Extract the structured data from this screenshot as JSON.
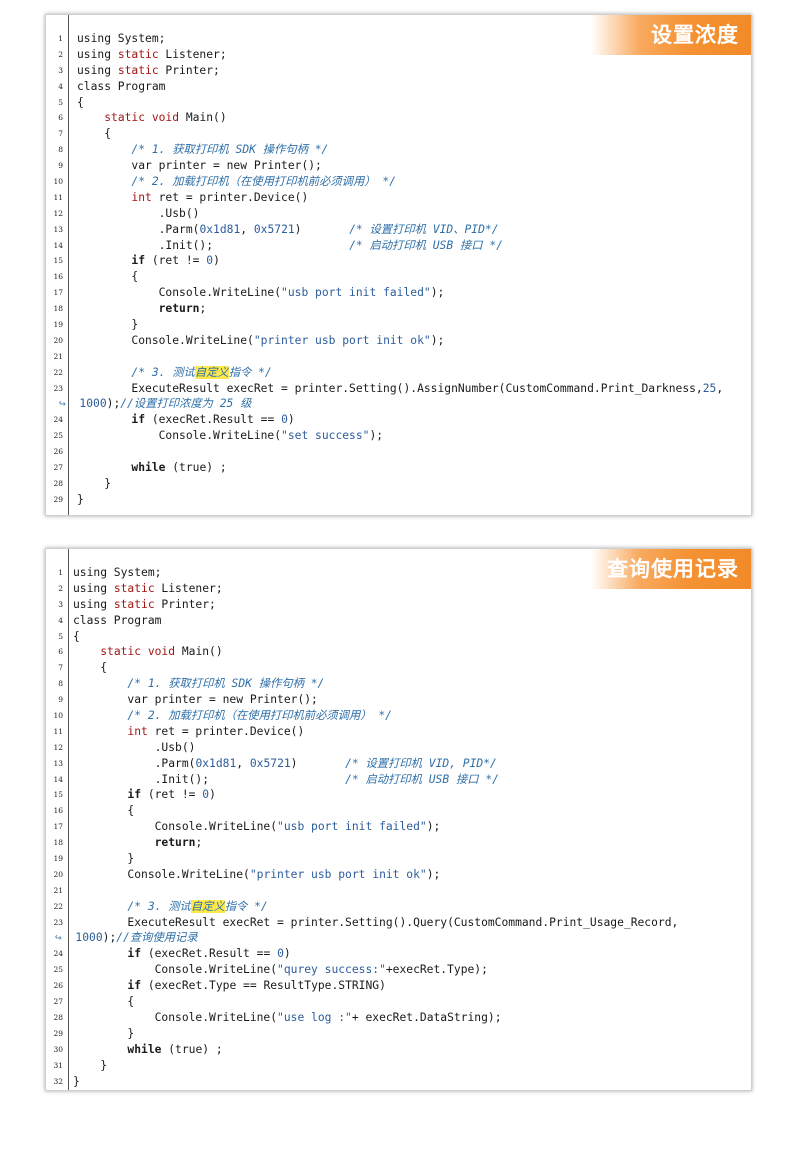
{
  "panels": [
    {
      "title": "设置浓度",
      "lines": [
        {
          "n": "1",
          "segs": [
            {
              "t": "using System;"
            }
          ]
        },
        {
          "n": "2",
          "segs": [
            {
              "t": "using "
            },
            {
              "t": "static",
              "c": "kw"
            },
            {
              "t": " Listener;"
            }
          ]
        },
        {
          "n": "3",
          "segs": [
            {
              "t": "using "
            },
            {
              "t": "static",
              "c": "kw"
            },
            {
              "t": " Printer;"
            }
          ]
        },
        {
          "n": "4",
          "segs": [
            {
              "t": "class Program"
            }
          ]
        },
        {
          "n": "5",
          "segs": [
            {
              "t": "{"
            }
          ]
        },
        {
          "n": "6",
          "segs": [
            {
              "t": "    "
            },
            {
              "t": "static void",
              "c": "kw"
            },
            {
              "t": " Main()"
            }
          ]
        },
        {
          "n": "7",
          "segs": [
            {
              "t": "    {"
            }
          ]
        },
        {
          "n": "8",
          "segs": [
            {
              "t": "        "
            },
            {
              "t": "/* 1. 获取打印机 SDK 操作句柄 */",
              "c": "cm"
            }
          ]
        },
        {
          "n": "9",
          "segs": [
            {
              "t": "        var printer = new Printer();"
            }
          ]
        },
        {
          "n": "10",
          "segs": [
            {
              "t": "        "
            },
            {
              "t": "/* 2. 加载打印机（在使用打印机前必须调用） */",
              "c": "cm"
            }
          ]
        },
        {
          "n": "11",
          "segs": [
            {
              "t": "        "
            },
            {
              "t": "int",
              "c": "kw"
            },
            {
              "t": " ret = printer.Device()"
            }
          ]
        },
        {
          "n": "12",
          "segs": [
            {
              "t": "            .Usb()"
            }
          ]
        },
        {
          "n": "13",
          "segs": [
            {
              "t": "            .Parm("
            },
            {
              "t": "0x1d81",
              "c": "nm"
            },
            {
              "t": ", "
            },
            {
              "t": "0x5721",
              "c": "nm"
            },
            {
              "t": ")       "
            },
            {
              "t": "/* 设置打印机 VID、PID*/",
              "c": "cm"
            }
          ]
        },
        {
          "n": "14",
          "segs": [
            {
              "t": "            .Init();                    "
            },
            {
              "t": "/* 启动打印机 USB 接口 */",
              "c": "cm"
            }
          ]
        },
        {
          "n": "15",
          "segs": [
            {
              "t": "        "
            },
            {
              "t": "if",
              "c": "kwb"
            },
            {
              "t": " (ret != "
            },
            {
              "t": "0",
              "c": "nm"
            },
            {
              "t": ")"
            }
          ]
        },
        {
          "n": "16",
          "segs": [
            {
              "t": "        {"
            }
          ]
        },
        {
          "n": "17",
          "segs": [
            {
              "t": "            Console.WriteLine("
            },
            {
              "t": "\"usb port init failed\"",
              "c": "st"
            },
            {
              "t": ");"
            }
          ]
        },
        {
          "n": "18",
          "segs": [
            {
              "t": "            "
            },
            {
              "t": "return",
              "c": "kwb"
            },
            {
              "t": ";"
            }
          ]
        },
        {
          "n": "19",
          "segs": [
            {
              "t": "        }"
            }
          ]
        },
        {
          "n": "20",
          "segs": [
            {
              "t": "        Console.WriteLine("
            },
            {
              "t": "\"printer usb port init ok\"",
              "c": "st"
            },
            {
              "t": ");"
            }
          ]
        },
        {
          "n": "21",
          "segs": [
            {
              "t": ""
            }
          ]
        },
        {
          "n": "22",
          "segs": [
            {
              "t": "        "
            },
            {
              "t": "/* 3. 测试",
              "c": "cm"
            },
            {
              "t": "自定义",
              "c": "cm hl"
            },
            {
              "t": "指令 */",
              "c": "cm"
            }
          ]
        },
        {
          "n": "23",
          "segs": [
            {
              "t": "        ExecuteResult execRet = printer.Setting().AssignNumber(CustomCommand.Print_Darkness,"
            },
            {
              "t": "25",
              "c": "nm"
            },
            {
              "t": ","
            }
          ]
        },
        {
          "n": "",
          "cont": true,
          "segs": [
            {
              "t": "↪ ",
              "c": "arrow"
            },
            {
              "t": " "
            },
            {
              "t": "1000",
              "c": "nm"
            },
            {
              "t": ");"
            },
            {
              "t": "//设置打印浓度为 25 级",
              "c": "cm"
            }
          ]
        },
        {
          "n": "24",
          "segs": [
            {
              "t": "        "
            },
            {
              "t": "if",
              "c": "kwb"
            },
            {
              "t": " (execRet.Result == "
            },
            {
              "t": "0",
              "c": "nm"
            },
            {
              "t": ")"
            }
          ]
        },
        {
          "n": "25",
          "segs": [
            {
              "t": "            Console.WriteLine("
            },
            {
              "t": "\"set success\"",
              "c": "st"
            },
            {
              "t": ");"
            }
          ]
        },
        {
          "n": "26",
          "segs": [
            {
              "t": ""
            }
          ]
        },
        {
          "n": "27",
          "segs": [
            {
              "t": "        "
            },
            {
              "t": "while",
              "c": "kwb"
            },
            {
              "t": " (true) ;"
            }
          ]
        },
        {
          "n": "28",
          "segs": [
            {
              "t": "    }"
            }
          ]
        },
        {
          "n": "29",
          "segs": [
            {
              "t": "}"
            }
          ]
        }
      ]
    },
    {
      "title": "查询使用记录",
      "lines": [
        {
          "n": "1",
          "segs": [
            {
              "t": "using System;"
            }
          ]
        },
        {
          "n": "2",
          "segs": [
            {
              "t": "using "
            },
            {
              "t": "static",
              "c": "kw"
            },
            {
              "t": " Listener;"
            }
          ]
        },
        {
          "n": "3",
          "segs": [
            {
              "t": "using "
            },
            {
              "t": "static",
              "c": "kw"
            },
            {
              "t": " Printer;"
            }
          ]
        },
        {
          "n": "4",
          "segs": [
            {
              "t": "class Program"
            }
          ]
        },
        {
          "n": "5",
          "segs": [
            {
              "t": "{"
            }
          ]
        },
        {
          "n": "6",
          "segs": [
            {
              "t": "    "
            },
            {
              "t": "static void",
              "c": "kw"
            },
            {
              "t": " Main()"
            }
          ]
        },
        {
          "n": "7",
          "segs": [
            {
              "t": "    {"
            }
          ]
        },
        {
          "n": "8",
          "segs": [
            {
              "t": "        "
            },
            {
              "t": "/* 1. 获取打印机 SDK 操作句柄 */",
              "c": "cm"
            }
          ]
        },
        {
          "n": "9",
          "segs": [
            {
              "t": "        var printer = new Printer();"
            }
          ]
        },
        {
          "n": "10",
          "segs": [
            {
              "t": "        "
            },
            {
              "t": "/* 2. 加载打印机（在使用打印机前必须调用） */",
              "c": "cm"
            }
          ]
        },
        {
          "n": "11",
          "segs": [
            {
              "t": "        "
            },
            {
              "t": "int",
              "c": "kw"
            },
            {
              "t": " ret = printer.Device()"
            }
          ]
        },
        {
          "n": "12",
          "segs": [
            {
              "t": "            .Usb()"
            }
          ]
        },
        {
          "n": "13",
          "segs": [
            {
              "t": "            .Parm("
            },
            {
              "t": "0x1d81",
              "c": "nm"
            },
            {
              "t": ", "
            },
            {
              "t": "0x5721",
              "c": "nm"
            },
            {
              "t": ")       "
            },
            {
              "t": "/* 设置打印机 VID, PID*/",
              "c": "cm"
            }
          ]
        },
        {
          "n": "14",
          "segs": [
            {
              "t": "            .Init();                    "
            },
            {
              "t": "/* 启动打印机 USB 接口 */",
              "c": "cm"
            }
          ]
        },
        {
          "n": "15",
          "segs": [
            {
              "t": "        "
            },
            {
              "t": "if",
              "c": "kwb"
            },
            {
              "t": " (ret != "
            },
            {
              "t": "0",
              "c": "nm"
            },
            {
              "t": ")"
            }
          ]
        },
        {
          "n": "16",
          "segs": [
            {
              "t": "        {"
            }
          ]
        },
        {
          "n": "17",
          "segs": [
            {
              "t": "            Console.WriteLine("
            },
            {
              "t": "\"usb port init failed\"",
              "c": "st"
            },
            {
              "t": ");"
            }
          ]
        },
        {
          "n": "18",
          "segs": [
            {
              "t": "            "
            },
            {
              "t": "return",
              "c": "kwb"
            },
            {
              "t": ";"
            }
          ]
        },
        {
          "n": "19",
          "segs": [
            {
              "t": "        }"
            }
          ]
        },
        {
          "n": "20",
          "segs": [
            {
              "t": "        Console.WriteLine("
            },
            {
              "t": "\"printer usb port init ok\"",
              "c": "st"
            },
            {
              "t": ");"
            }
          ]
        },
        {
          "n": "21",
          "segs": [
            {
              "t": ""
            }
          ]
        },
        {
          "n": "22",
          "segs": [
            {
              "t": "        "
            },
            {
              "t": "/* 3. 测试",
              "c": "cm"
            },
            {
              "t": "自定义",
              "c": "cm hl"
            },
            {
              "t": "指令 */",
              "c": "cm"
            }
          ]
        },
        {
          "n": "23",
          "segs": [
            {
              "t": "        ExecuteResult execRet = printer.Setting().Query(CustomCommand.Print_Usage_Record,"
            }
          ]
        },
        {
          "n": "",
          "cont": true,
          "segs": [
            {
              "t": "↪ ",
              "c": "arrow"
            },
            {
              "t": " "
            },
            {
              "t": "1000",
              "c": "nm"
            },
            {
              "t": ");"
            },
            {
              "t": "//查询使用记录",
              "c": "cm"
            }
          ]
        },
        {
          "n": "24",
          "segs": [
            {
              "t": "        "
            },
            {
              "t": "if",
              "c": "kwb"
            },
            {
              "t": " (execRet.Result == "
            },
            {
              "t": "0",
              "c": "nm"
            },
            {
              "t": ")"
            }
          ]
        },
        {
          "n": "25",
          "segs": [
            {
              "t": "            Console.WriteLine("
            },
            {
              "t": "\"qurey success:\"",
              "c": "st"
            },
            {
              "t": "+execRet.Type);"
            }
          ]
        },
        {
          "n": "26",
          "segs": [
            {
              "t": "        "
            },
            {
              "t": "if",
              "c": "kwb"
            },
            {
              "t": " (execRet.Type == ResultType.STRING)"
            }
          ]
        },
        {
          "n": "27",
          "segs": [
            {
              "t": "        {"
            }
          ]
        },
        {
          "n": "28",
          "segs": [
            {
              "t": "            Console.WriteLine("
            },
            {
              "t": "\"use log :\"",
              "c": "st"
            },
            {
              "t": "+ execRet.DataString);"
            }
          ]
        },
        {
          "n": "29",
          "segs": [
            {
              "t": "        }"
            }
          ]
        },
        {
          "n": "30",
          "segs": [
            {
              "t": "        "
            },
            {
              "t": "while",
              "c": "kwb"
            },
            {
              "t": " (true) ;"
            }
          ]
        },
        {
          "n": "31",
          "segs": [
            {
              "t": "    }"
            }
          ]
        },
        {
          "n": "32",
          "segs": [
            {
              "t": "}"
            }
          ]
        }
      ]
    }
  ]
}
